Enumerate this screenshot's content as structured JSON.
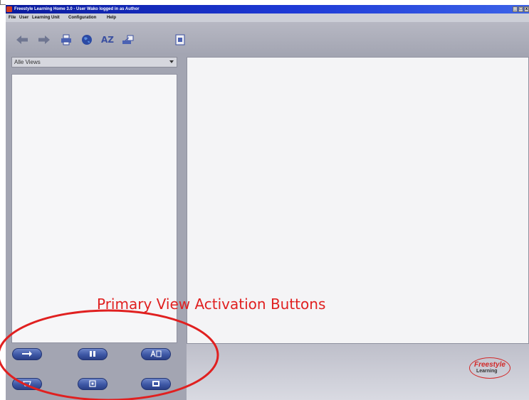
{
  "window": {
    "title": "Freestyle Learning Home 3.0 - User Wako logged in as Author",
    "controls": {
      "minimize": "_",
      "maximize": "□",
      "close": "x"
    }
  },
  "menubar": {
    "items": [
      "File",
      "User",
      "Learning Unit",
      "Configuration",
      "Help"
    ]
  },
  "toolbar": {
    "icons": [
      "back-arrow-icon",
      "forward-arrow-icon",
      "print-icon",
      "globe-icon",
      "sort-az-icon",
      "user-connect-icon",
      "document-icon"
    ],
    "az_text": "AZ"
  },
  "left_panel": {
    "view_selector": {
      "selected": "Alle Views"
    }
  },
  "view_buttons": {
    "row1": [
      "arrow-right-icon",
      "pause-icon",
      "text-icon"
    ],
    "row2": [
      "box-icon",
      "square-icon",
      "image-icon"
    ]
  },
  "branding": {
    "logo_main": "Freestyle",
    "logo_sub": "Learning"
  },
  "annotation": {
    "text": "Primary View Activation Buttons",
    "color": "#e02020"
  },
  "colors": {
    "titlebar": "#0a1a9c",
    "panel": "#a3a5b2",
    "button": "#3d57a5",
    "accent": "#d22a2a"
  }
}
